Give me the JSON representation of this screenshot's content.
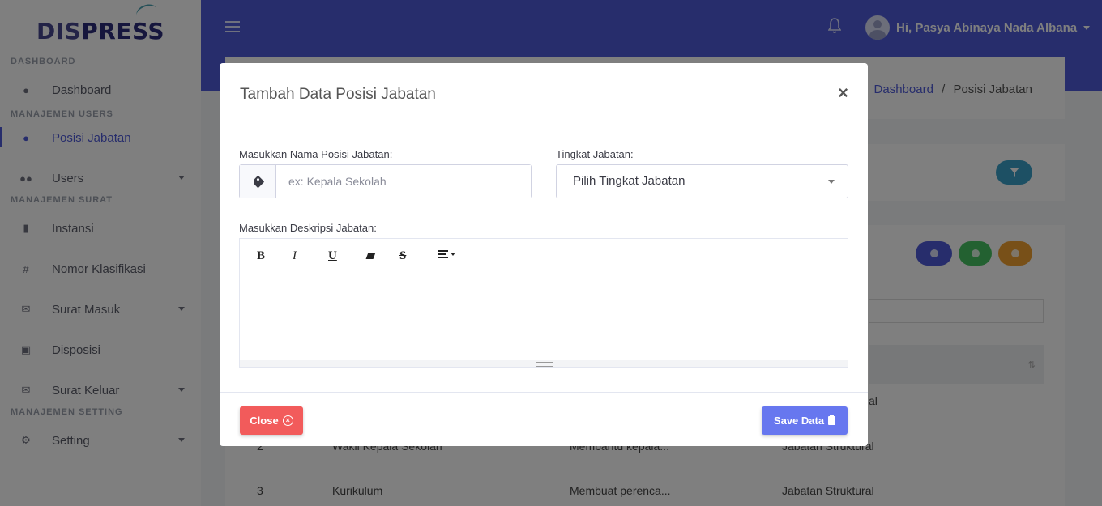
{
  "brand": {
    "part1": "DIS",
    "part2": "PRESS"
  },
  "sidebar": {
    "sections": [
      {
        "title": "DASHBOARD"
      },
      {
        "title": "MANAJEMEN USERS"
      },
      {
        "title": "MANAJEMEN SURAT"
      },
      {
        "title": "MANAJEMEN SETTING"
      }
    ],
    "items": [
      {
        "label": "Dashboard",
        "icon": "fire-icon"
      },
      {
        "label": "Posisi Jabatan",
        "icon": "user-icon",
        "active": true
      },
      {
        "label": "Users",
        "icon": "users-icon"
      },
      {
        "label": "Instansi",
        "icon": "building-icon"
      },
      {
        "label": "Nomor Klasifikasi",
        "icon": "hash-icon"
      },
      {
        "label": "Surat Masuk",
        "icon": "envelope-icon"
      },
      {
        "label": "Disposisi",
        "icon": "inbox-icon"
      },
      {
        "label": "Surat Keluar",
        "icon": "envelope-open-icon"
      },
      {
        "label": "Setting",
        "icon": "gear-icon"
      }
    ]
  },
  "topbar": {
    "greeting": "Hi, Pasya Abinaya Nada Albana"
  },
  "breadcrumb": {
    "link": "Dashboard",
    "separator": "/",
    "current": "Posisi Jabatan"
  },
  "table": {
    "rows": [
      {
        "no": "2",
        "nama": "Wakil Kepala Sekolah",
        "deskripsi": "Membantu kepala...",
        "tingkat": "Jabatan Struktural"
      },
      {
        "no": "3",
        "nama": "Kurikulum",
        "deskripsi": "Membuat perenca...",
        "tingkat": "Jabatan Struktural"
      }
    ],
    "partial_tingkat_row1": "al"
  },
  "modal": {
    "title": "Tambah Data Posisi Jabatan",
    "close_symbol": "×",
    "name_label": "Masukkan Nama Posisi Jabatan:",
    "name_placeholder": "ex: Kepala Sekolah",
    "name_value": "",
    "level_label": "Tingkat Jabatan:",
    "level_selected": "Pilih Tingkat Jabatan",
    "desc_label": "Masukkan Deskripsi Jabatan:",
    "toolbar": {
      "bold": "B",
      "italic": "I",
      "underline": "U",
      "strike": "S"
    },
    "close_button": "Close",
    "save_button": "Save Data"
  },
  "colors": {
    "primary": "#4e5ad8",
    "danger": "#f25b5b",
    "save": "#6777ef",
    "info": "#3aa0c8",
    "success": "#47c363",
    "warning": "#f0a030"
  }
}
